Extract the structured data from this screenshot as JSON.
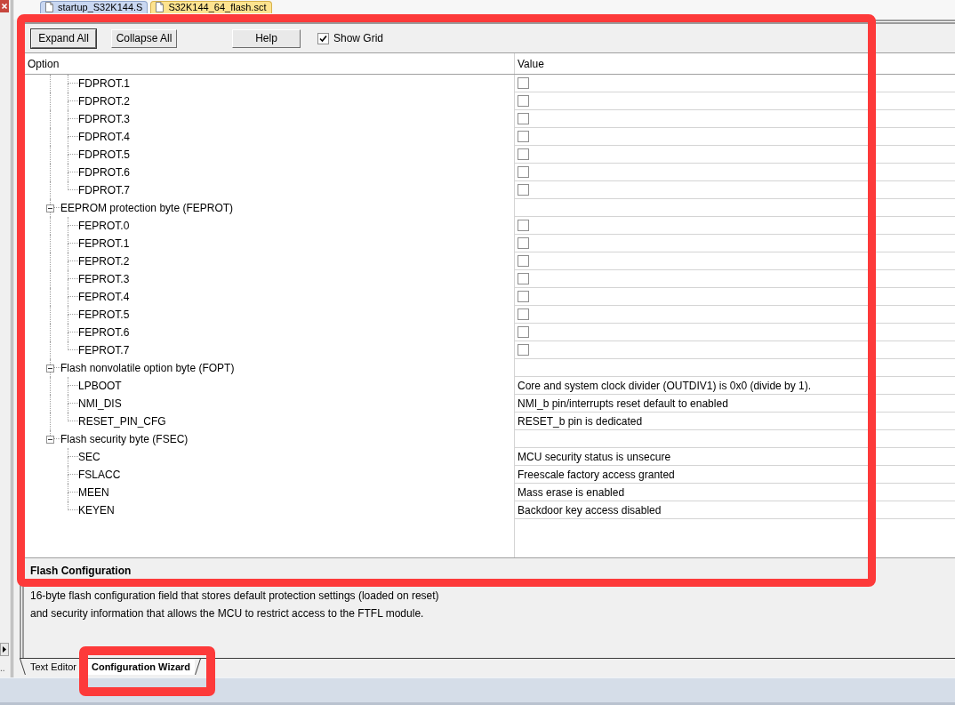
{
  "left_panel": {
    "tab_label": ".."
  },
  "file_tabs": [
    {
      "label": "startup_S32K144.S",
      "selected": false
    },
    {
      "label": "S32K144_64_flash.sct",
      "selected": true
    }
  ],
  "toolbar": {
    "buttons": [
      {
        "label": "Expand All",
        "focused": true
      },
      {
        "label": "Collapse All",
        "focused": false
      },
      {
        "label": "Help",
        "focused": false
      }
    ],
    "show_grid": {
      "label": "Show Grid",
      "checked": true
    }
  },
  "table": {
    "columns": [
      "Option",
      "Value"
    ],
    "groups": [
      {
        "children": [
          {
            "label": "FDPROT.1",
            "kind": "checkbox",
            "checked": false
          },
          {
            "label": "FDPROT.2",
            "kind": "checkbox",
            "checked": false
          },
          {
            "label": "FDPROT.3",
            "kind": "checkbox",
            "checked": false
          },
          {
            "label": "FDPROT.4",
            "kind": "checkbox",
            "checked": false
          },
          {
            "label": "FDPROT.5",
            "kind": "checkbox",
            "checked": false
          },
          {
            "label": "FDPROT.6",
            "kind": "checkbox",
            "checked": false
          },
          {
            "label": "FDPROT.7",
            "kind": "checkbox",
            "checked": false
          }
        ]
      },
      {
        "label": "EEPROM protection byte (FEPROT)",
        "expanded": true,
        "children": [
          {
            "label": "FEPROT.0",
            "kind": "checkbox",
            "checked": false
          },
          {
            "label": "FEPROT.1",
            "kind": "checkbox",
            "checked": false
          },
          {
            "label": "FEPROT.2",
            "kind": "checkbox",
            "checked": false
          },
          {
            "label": "FEPROT.3",
            "kind": "checkbox",
            "checked": false
          },
          {
            "label": "FEPROT.4",
            "kind": "checkbox",
            "checked": false
          },
          {
            "label": "FEPROT.5",
            "kind": "checkbox",
            "checked": false
          },
          {
            "label": "FEPROT.6",
            "kind": "checkbox",
            "checked": false
          },
          {
            "label": "FEPROT.7",
            "kind": "checkbox",
            "checked": false
          }
        ]
      },
      {
        "label": "Flash nonvolatile option byte (FOPT)",
        "expanded": true,
        "children": [
          {
            "label": "LPBOOT",
            "kind": "text",
            "value": "Core and system clock divider (OUTDIV1) is 0x0 (divide by 1)."
          },
          {
            "label": "NMI_DIS",
            "kind": "text",
            "value": "NMI_b pin/interrupts reset default to enabled"
          },
          {
            "label": "RESET_PIN_CFG",
            "kind": "text",
            "value": "RESET_b pin is dedicated"
          }
        ]
      },
      {
        "label": "Flash security byte (FSEC)",
        "expanded": true,
        "children": [
          {
            "label": "SEC",
            "kind": "text",
            "value": "MCU security status is unsecure"
          },
          {
            "label": "FSLACC",
            "kind": "text",
            "value": "Freescale factory access granted"
          },
          {
            "label": "MEEN",
            "kind": "text",
            "value": "Mass erase is enabled"
          },
          {
            "label": "KEYEN",
            "kind": "text",
            "value": "Backdoor key access disabled"
          }
        ]
      }
    ]
  },
  "description": {
    "title": "Flash Configuration",
    "text": "16-byte flash configuration field that stores default protection settings (loaded on reset)\nand security information that allows the MCU to restrict access to the FTFL module."
  },
  "view_tabs": [
    {
      "label": "Text Editor",
      "selected": false
    },
    {
      "label": "Configuration Wizard",
      "selected": true
    }
  ]
}
